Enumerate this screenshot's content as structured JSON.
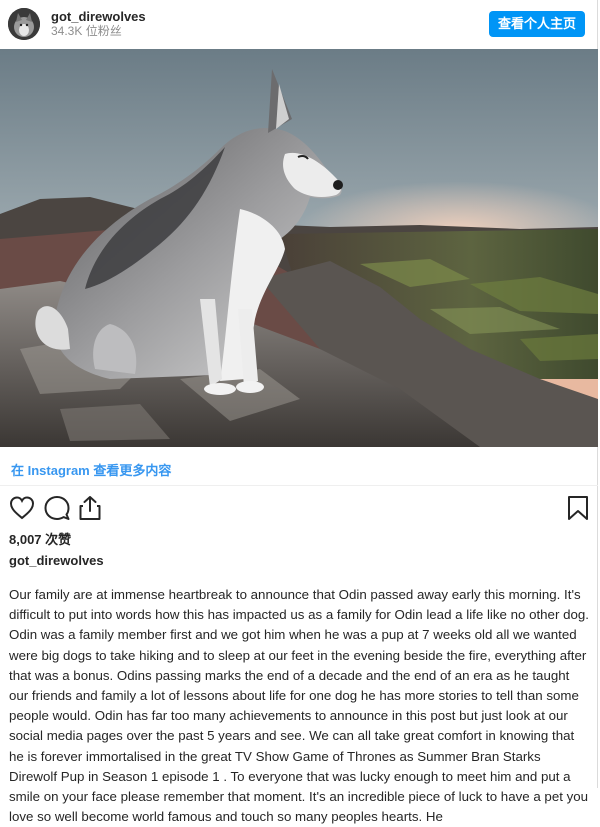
{
  "header": {
    "username": "got_direwolves",
    "followers": "34.3K 位粉丝",
    "view_profile": "查看个人主页"
  },
  "post": {
    "view_more_link": "在 Instagram 查看更多内容",
    "likes": "8,007 次赞",
    "poster_username": "got_direwolves",
    "caption": "Our family are at immense heartbreak to announce that Odin passed away early this morning. It's difficult to put into words how this has impacted us as a family for Odin lead a life like no other dog. Odin was a family member first and we got him when he was a pup at 7 weeks old all we wanted were big dogs to take hiking and to sleep at our feet in the evening beside the fire, everything after that was a bonus. Odins passing marks the end of a decade and the end of an era as he taught our friends and family a lot of lessons about life for one dog he has more stories to tell than some people would. Odin has far too many achievements to announce in this post but just look at our social media pages over the past 5 years and see. We can all take great comfort in knowing that he is forever immortalised in the great TV Show Game of Thrones as Summer Bran Starks Direwolf Pup in Season 1 episode 1 . To everyone that was lucky enough to meet him and put a smile on your face please remember that moment. It's an incredible piece of luck to have a pet you love so well become world famous and touch so many peoples hearts. He"
  },
  "icons": {
    "like": "heart-icon",
    "comment": "comment-icon",
    "share": "share-icon",
    "save": "bookmark-icon"
  },
  "colors": {
    "accent": "#0095f6",
    "link": "#3897f0",
    "text": "#262626",
    "muted": "#8e8e8e"
  }
}
